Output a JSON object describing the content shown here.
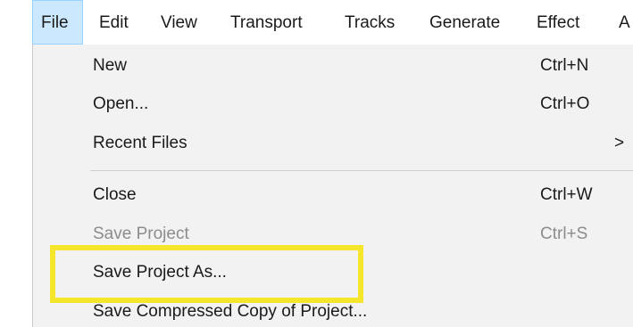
{
  "menubar": {
    "items": [
      {
        "label": "File"
      },
      {
        "label": "Edit"
      },
      {
        "label": "View"
      },
      {
        "label": "Transport"
      },
      {
        "label": "Tracks"
      },
      {
        "label": "Generate"
      },
      {
        "label": "Effect"
      },
      {
        "label": "A"
      }
    ]
  },
  "file_menu": {
    "items": [
      {
        "label": "New",
        "shortcut": "Ctrl+N"
      },
      {
        "label": "Open...",
        "shortcut": "Ctrl+O"
      },
      {
        "label": "Recent Files",
        "submenu_arrow": ">"
      },
      {
        "label": "Close",
        "shortcut": "Ctrl+W"
      },
      {
        "label": "Save Project",
        "shortcut": "Ctrl+S"
      },
      {
        "label": "Save Project As..."
      },
      {
        "label": "Save Compressed Copy of Project..."
      }
    ]
  },
  "colors": {
    "active_menu_bg": "#cce8ff",
    "dropdown_bg": "#f2f2f2",
    "disabled_text": "#8c8c8c",
    "highlight": "#f5e62c"
  }
}
